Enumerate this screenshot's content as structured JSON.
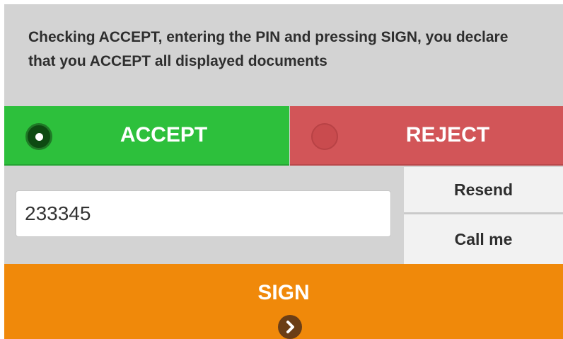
{
  "declaration": {
    "text": "Checking ACCEPT, entering the PIN and pressing SIGN, you declare that you ACCEPT all displayed documents"
  },
  "choices": {
    "accept": {
      "label": "ACCEPT",
      "selected": true,
      "color": "#2dc03c"
    },
    "reject": {
      "label": "REJECT",
      "selected": false,
      "color": "#d25558"
    }
  },
  "pin": {
    "value": "233345"
  },
  "actions": {
    "resend_label": "Resend",
    "call_label": "Call me"
  },
  "sign": {
    "label": "SIGN",
    "icon": "chevron-right-circle-icon",
    "color": "#f0890a"
  }
}
